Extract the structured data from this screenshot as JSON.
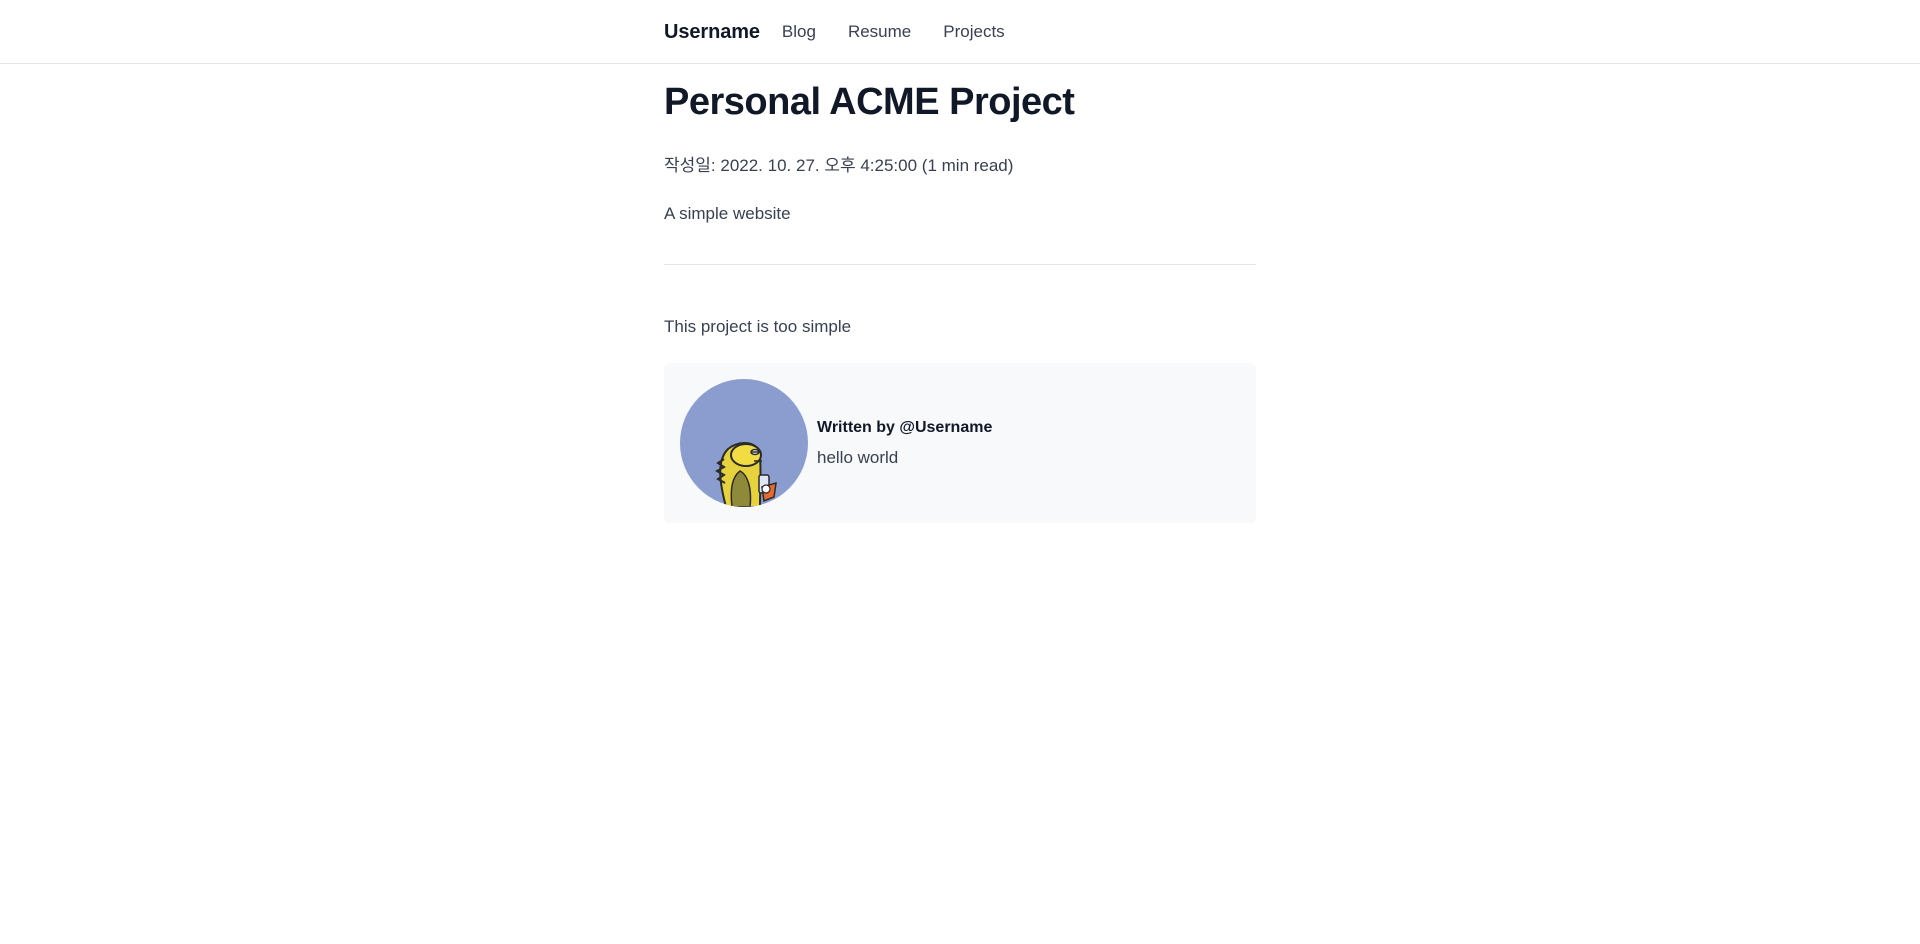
{
  "nav": {
    "brand": "Username",
    "links": [
      "Blog",
      "Resume",
      "Projects"
    ]
  },
  "post": {
    "title": "Personal ACME Project",
    "meta": "작성일: 2022. 10. 27. 오후 4:25:00 (1 min read)",
    "description": "A simple website",
    "body": "This project is too simple"
  },
  "author": {
    "written_by": "Written by @Username",
    "bio": "hello world",
    "avatar_icon": "avatar-fish-illustration",
    "avatar_bg": "#8b9ccf"
  },
  "colors": {
    "heading": "#111827",
    "text": "#374151",
    "border": "#e5e7eb",
    "card_bg": "#f8f9fb"
  }
}
